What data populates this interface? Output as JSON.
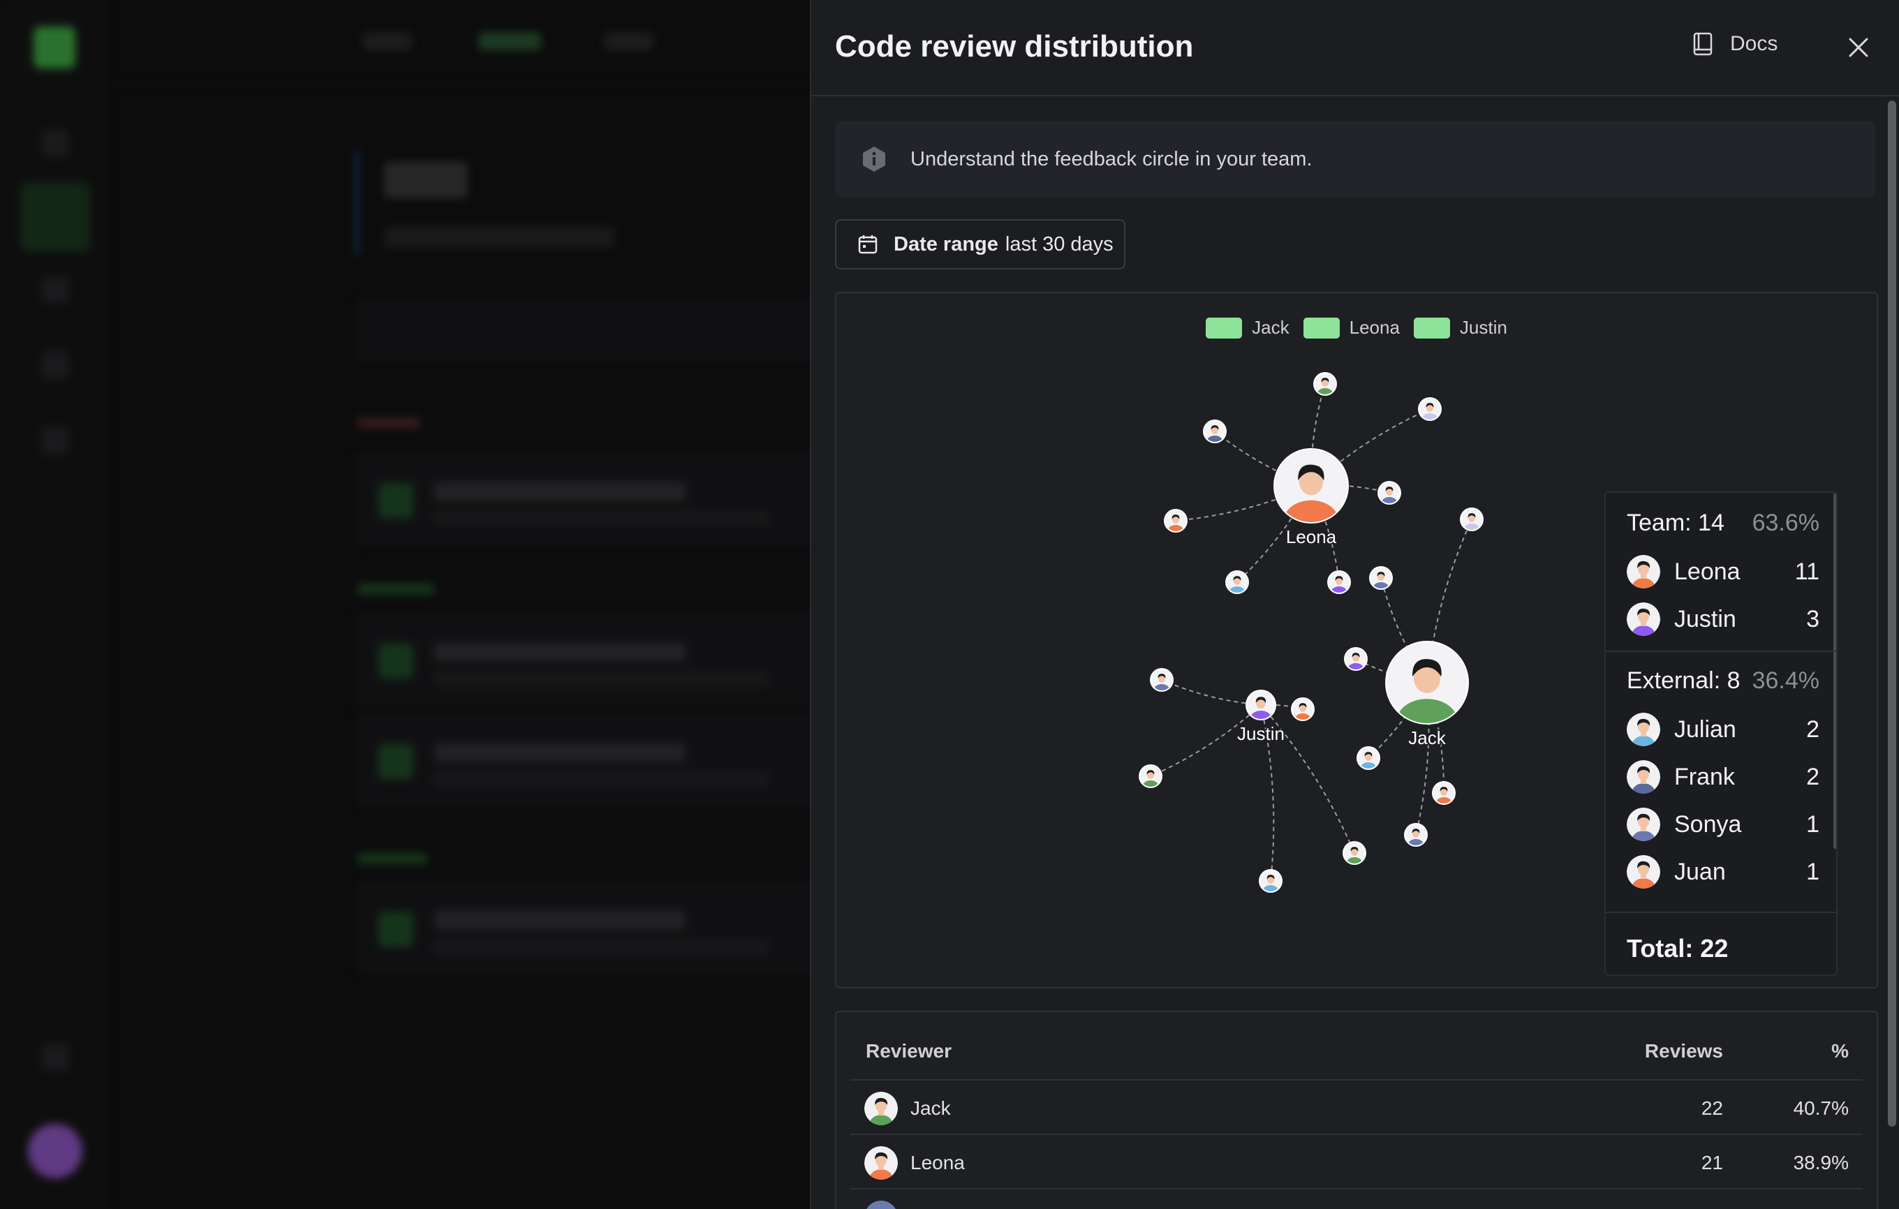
{
  "panel": {
    "title": "Code review distribution",
    "docs_label": "Docs",
    "info_text": "Understand the feedback circle in your team.",
    "date_range_label": "Date range",
    "date_range_value": "last 30 days"
  },
  "colors": {
    "accent_green": "#8ee39a",
    "panel_bg": "#1c1d21",
    "edge": "#9a9aa0"
  },
  "legend": [
    "Jack",
    "Leona",
    "Justin"
  ],
  "graph": {
    "hubs": [
      {
        "name": "Leona",
        "shirt": "#f07a4a",
        "hair": "#1a1a1a",
        "skin": "#f4c9b0"
      },
      {
        "name": "Jack",
        "shirt": "#5fa15a",
        "hair": "#1a1a1a",
        "skin": "#f4c9b0"
      },
      {
        "name": "Justin",
        "shirt": "#8e5cf0",
        "hair": "#1a1a1a",
        "skin": "#f4c9b0"
      }
    ]
  },
  "tooltip": {
    "team_label": "Team: 14",
    "team_pct": "63.6%",
    "team_members": [
      {
        "name": "Leona",
        "count": "11",
        "shirt": "#f07a4a"
      },
      {
        "name": "Justin",
        "count": "3",
        "shirt": "#8e5cf0"
      }
    ],
    "external_label": "External: 8",
    "external_pct": "36.4%",
    "external_members": [
      {
        "name": "Julian",
        "count": "2",
        "shirt": "#6fb3e0"
      },
      {
        "name": "Frank",
        "count": "2",
        "shirt": "#5b6a9a"
      },
      {
        "name": "Sonya",
        "count": "1",
        "shirt": "#6a7ab0"
      },
      {
        "name": "Juan",
        "count": "1",
        "shirt": "#f07a4a"
      }
    ],
    "total": "Total: 22"
  },
  "table": {
    "headers": [
      "Reviewer",
      "Reviews",
      "%"
    ],
    "rows": [
      {
        "name": "Jack",
        "reviews": "22",
        "pct": "40.7%",
        "shirt": "#5fa15a"
      },
      {
        "name": "Leona",
        "reviews": "21",
        "pct": "38.9%",
        "shirt": "#f07a4a"
      }
    ]
  }
}
